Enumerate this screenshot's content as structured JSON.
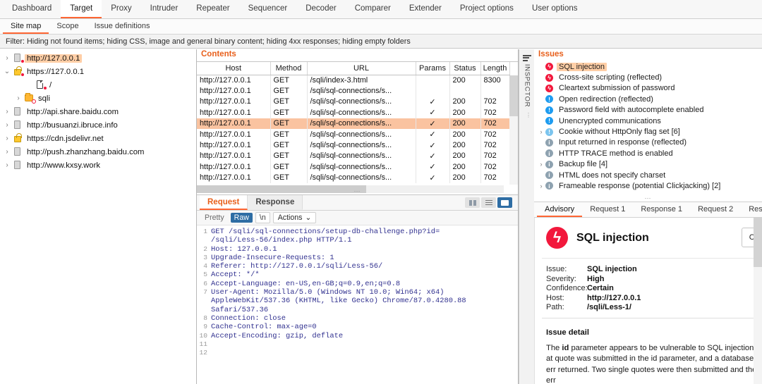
{
  "window": {
    "top_tabs": [
      {
        "label": "Dashboard",
        "active": false
      },
      {
        "label": "Target",
        "active": true
      },
      {
        "label": "Proxy",
        "active": false
      },
      {
        "label": "Intruder",
        "active": false
      },
      {
        "label": "Repeater",
        "active": false
      },
      {
        "label": "Sequencer",
        "active": false
      },
      {
        "label": "Decoder",
        "active": false
      },
      {
        "label": "Comparer",
        "active": false
      },
      {
        "label": "Extender",
        "active": false
      },
      {
        "label": "Project options",
        "active": false
      },
      {
        "label": "User options",
        "active": false
      }
    ],
    "sub_tabs": [
      {
        "label": "Site map",
        "active": true
      },
      {
        "label": "Scope",
        "active": false
      },
      {
        "label": "Issue definitions",
        "active": false
      }
    ],
    "filter_bar": "Filter: Hiding not found items;  hiding CSS, image and general binary content;  hiding 4xx responses;  hiding empty folders"
  },
  "sitemap": {
    "nodes": [
      {
        "label": "http://127.0.0.1",
        "indent": 0,
        "arrow": "›",
        "icon": "server-icon",
        "dot": "red",
        "selected": true
      },
      {
        "label": "https://127.0.0.1",
        "indent": 0,
        "arrow": "⌄",
        "icon": "lock-icon",
        "dot": "red",
        "selected": false
      },
      {
        "label": "/",
        "indent": 2,
        "arrow": "",
        "icon": "page-icon",
        "dot": "red",
        "selected": false
      },
      {
        "label": "sqli",
        "indent": 1,
        "arrow": "›",
        "icon": "folder-icon",
        "dot": "hollow",
        "selected": false
      },
      {
        "label": "http://api.share.baidu.com",
        "indent": 0,
        "arrow": "›",
        "icon": "server-icon",
        "dot": "none",
        "selected": false
      },
      {
        "label": "http://busuanzi.ibruce.info",
        "indent": 0,
        "arrow": "›",
        "icon": "server-icon",
        "dot": "none",
        "selected": false
      },
      {
        "label": "https://cdn.jsdelivr.net",
        "indent": 0,
        "arrow": "›",
        "icon": "lock-icon",
        "dot": "none",
        "selected": false
      },
      {
        "label": "http://push.zhanzhang.baidu.com",
        "indent": 0,
        "arrow": "›",
        "icon": "server-icon",
        "dot": "none",
        "selected": false
      },
      {
        "label": "http://www.kxsy.work",
        "indent": 0,
        "arrow": "›",
        "icon": "server-icon",
        "dot": "none",
        "selected": false
      }
    ]
  },
  "contents": {
    "title": "Contents",
    "columns": [
      "Host",
      "Method",
      "URL",
      "Params",
      "Status",
      "Length"
    ],
    "rows": [
      {
        "host": "http://127.0.0.1",
        "method": "GET",
        "url": "/sqli/index-3.html",
        "params": "",
        "status": "200",
        "length": "8300",
        "selected": false
      },
      {
        "host": "http://127.0.0.1",
        "method": "GET",
        "url": "/sqli/sql-connections/s...",
        "params": "",
        "status": "",
        "length": "",
        "selected": false
      },
      {
        "host": "http://127.0.0.1",
        "method": "GET",
        "url": "/sqli/sql-connections/s...",
        "params": "✓",
        "status": "200",
        "length": "702",
        "selected": false
      },
      {
        "host": "http://127.0.0.1",
        "method": "GET",
        "url": "/sqli/sql-connections/s...",
        "params": "✓",
        "status": "200",
        "length": "702",
        "selected": false
      },
      {
        "host": "http://127.0.0.1",
        "method": "GET",
        "url": "/sqli/sql-connections/s...",
        "params": "✓",
        "status": "200",
        "length": "702",
        "selected": true
      },
      {
        "host": "http://127.0.0.1",
        "method": "GET",
        "url": "/sqli/sql-connections/s...",
        "params": "✓",
        "status": "200",
        "length": "702",
        "selected": false
      },
      {
        "host": "http://127.0.0.1",
        "method": "GET",
        "url": "/sqli/sql-connections/s...",
        "params": "✓",
        "status": "200",
        "length": "702",
        "selected": false
      },
      {
        "host": "http://127.0.0.1",
        "method": "GET",
        "url": "/sqli/sql-connections/s...",
        "params": "✓",
        "status": "200",
        "length": "702",
        "selected": false
      },
      {
        "host": "http://127.0.0.1",
        "method": "GET",
        "url": "/sqli/sql-connections/s...",
        "params": "✓",
        "status": "200",
        "length": "702",
        "selected": false
      },
      {
        "host": "http://127.0.0.1",
        "method": "GET",
        "url": "/sqli/sql-connections/s...",
        "params": "✓",
        "status": "200",
        "length": "702",
        "selected": false
      }
    ]
  },
  "message_editor": {
    "tabs": [
      {
        "label": "Request",
        "active": true
      },
      {
        "label": "Response",
        "active": false
      }
    ],
    "view_buttons": [
      "split-view-icon",
      "list-view-icon",
      "single-view-icon"
    ],
    "format_buttons": [
      {
        "label": "Pretty",
        "state": "off"
      },
      {
        "label": "Raw",
        "state": "on"
      },
      {
        "label": "\\n",
        "state": "box"
      }
    ],
    "actions_label": "Actions",
    "request_lines": [
      {
        "num": "1",
        "text": "GET /sqli/sql-connections/setup-db-challenge.php?id="
      },
      {
        "num": "",
        "text": "/sqli/Less-56/index.php HTTP/1.1"
      },
      {
        "num": "2",
        "text": "Host: 127.0.0.1"
      },
      {
        "num": "3",
        "text": "Upgrade-Insecure-Requests: 1"
      },
      {
        "num": "4",
        "text": "Referer: http://127.0.0.1/sqli/Less-56/"
      },
      {
        "num": "5",
        "text": "Accept: */*"
      },
      {
        "num": "6",
        "text": "Accept-Language: en-US,en-GB;q=0.9,en;q=0.8"
      },
      {
        "num": "7",
        "text": "User-Agent: Mozilla/5.0 (Windows NT 10.0; Win64; x64)"
      },
      {
        "num": "",
        "text": "AppleWebKit/537.36 (KHTML, like Gecko) Chrome/87.0.4280.88"
      },
      {
        "num": "",
        "text": "Safari/537.36"
      },
      {
        "num": "8",
        "text": "Connection: close"
      },
      {
        "num": "9",
        "text": "Cache-Control: max-age=0"
      },
      {
        "num": "10",
        "text": "Accept-Encoding: gzip, deflate"
      },
      {
        "num": "11",
        "text": ""
      },
      {
        "num": "12",
        "text": ""
      }
    ],
    "inspector_label": "INSPECTOR"
  },
  "issues": {
    "title": "Issues",
    "items": [
      {
        "label": "SQL injection",
        "severity": "high",
        "arrow": "",
        "selected": true
      },
      {
        "label": "Cross-site scripting (reflected)",
        "severity": "high",
        "arrow": "",
        "selected": false
      },
      {
        "label": "Cleartext submission of password",
        "severity": "high",
        "arrow": "",
        "selected": false
      },
      {
        "label": "Open redirection (reflected)",
        "severity": "med",
        "arrow": "",
        "selected": false
      },
      {
        "label": "Password field with autocomplete enabled",
        "severity": "med",
        "arrow": "",
        "selected": false
      },
      {
        "label": "Unencrypted communications",
        "severity": "med",
        "arrow": "",
        "selected": false
      },
      {
        "label": "Cookie without HttpOnly flag set [6]",
        "severity": "low",
        "arrow": "›",
        "selected": false
      },
      {
        "label": "Input returned in response (reflected)",
        "severity": "info",
        "arrow": "",
        "selected": false
      },
      {
        "label": "HTTP TRACE method is enabled",
        "severity": "info",
        "arrow": "",
        "selected": false
      },
      {
        "label": "Backup file [4]",
        "severity": "info",
        "arrow": "›",
        "selected": false
      },
      {
        "label": "HTML does not specify charset",
        "severity": "info",
        "arrow": "",
        "selected": false
      },
      {
        "label": "Frameable response (potential Clickjacking) [2]",
        "severity": "info",
        "arrow": "›",
        "selected": false
      }
    ]
  },
  "advisory": {
    "tabs": [
      {
        "label": "Advisory",
        "active": true
      },
      {
        "label": "Request 1",
        "active": false
      },
      {
        "label": "Response 1",
        "active": false
      },
      {
        "label": "Request 2",
        "active": false
      },
      {
        "label": "Response",
        "active": false
      }
    ],
    "badge_glyph": "⚡",
    "heading": "SQL injection",
    "action_button": "Com",
    "meta": [
      {
        "key": "Issue:",
        "value": "SQL injection"
      },
      {
        "key": "Severity:",
        "value": "High"
      },
      {
        "key": "Confidence:",
        "value": "Certain"
      },
      {
        "key": "Host:",
        "value": "http://127.0.0.1"
      },
      {
        "key": "Path:",
        "value": "/sqli/Less-1/"
      }
    ],
    "detail_heading": "Issue detail",
    "detail_text_1": "The ",
    "detail_bold": "id",
    "detail_text_2": " parameter appears to be vulnerable to SQL injection at",
    "detail_line_2": "quote was submitted in the id parameter, and a database err",
    "detail_line_3": "returned. Two single quotes were then submitted and the err"
  },
  "colors": {
    "accent": "#ff6633",
    "title_orange": "#e8601c",
    "selection": "#ffcea6",
    "row_selected": "#fac3a0",
    "severity_high": "#f2183c",
    "severity_medium": "#1e9cf0",
    "severity_low": "#7bc4ee",
    "severity_info": "#8ea2b0",
    "mono_text": "#30308f"
  }
}
